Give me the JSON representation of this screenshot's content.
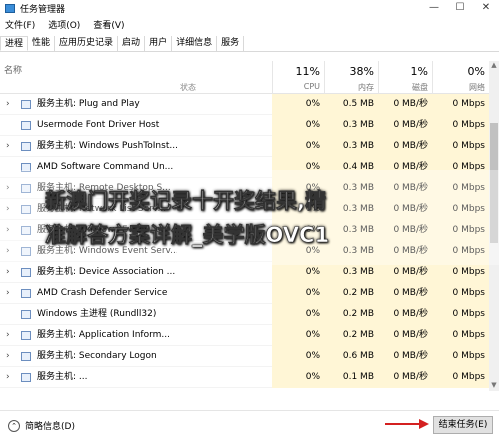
{
  "window": {
    "title": "任务管理器",
    "controls": [
      "—",
      "☐",
      "✕"
    ]
  },
  "menu": [
    "文件(F)",
    "选项(O)",
    "查看(V)"
  ],
  "tabs": [
    "进程",
    "性能",
    "应用历史记录",
    "启动",
    "用户",
    "详细信息",
    "服务"
  ],
  "columns": {
    "name": "名称",
    "status": "状态",
    "cpu": {
      "pct": "11%",
      "label": "CPU"
    },
    "memory": {
      "pct": "38%",
      "label": "内存"
    },
    "disk": {
      "pct": "1%",
      "label": "磁盘"
    },
    "network": {
      "pct": "0%",
      "label": "网络"
    }
  },
  "rows": [
    {
      "name": "服务主机: Plug and Play",
      "cpu": "0%",
      "mem": "0.5 MB",
      "disk": "0 MB/秒",
      "net": "0 Mbps",
      "expand": "›"
    },
    {
      "name": "Usermode Font Driver Host",
      "cpu": "0%",
      "mem": "0.3 MB",
      "disk": "0 MB/秒",
      "net": "0 Mbps",
      "expand": ""
    },
    {
      "name": "服务主机: Windows PushToInst...",
      "cpu": "0%",
      "mem": "0.3 MB",
      "disk": "0 MB/秒",
      "net": "0 Mbps",
      "expand": "›"
    },
    {
      "name": "AMD Software Command Un...",
      "cpu": "0%",
      "mem": "0.4 MB",
      "disk": "0 MB/秒",
      "net": "0 Mbps",
      "expand": ""
    },
    {
      "name": "服务主机: Remote Desktop S...",
      "cpu": "0%",
      "mem": "0.3 MB",
      "disk": "0 MB/秒",
      "net": "0 Mbps",
      "expand": "›"
    },
    {
      "name": "服务主机: Network List Serv...",
      "cpu": "0%",
      "mem": "0.3 MB",
      "disk": "0 MB/秒",
      "net": "0 Mbps",
      "expand": "›"
    },
    {
      "name": "服务主机: Windows Event Lo...",
      "cpu": "0%",
      "mem": "0.3 MB",
      "disk": "0 MB/秒",
      "net": "0 Mbps",
      "expand": "›"
    },
    {
      "name": "服务主机: Windows Event Serv...",
      "cpu": "0%",
      "mem": "0.3 MB",
      "disk": "0 MB/秒",
      "net": "0 Mbps",
      "expand": "›"
    },
    {
      "name": "服务主机: Device Association ...",
      "cpu": "0%",
      "mem": "0.3 MB",
      "disk": "0 MB/秒",
      "net": "0 Mbps",
      "expand": "›"
    },
    {
      "name": "AMD Crash Defender Service",
      "cpu": "0%",
      "mem": "0.2 MB",
      "disk": "0 MB/秒",
      "net": "0 Mbps",
      "expand": "›"
    },
    {
      "name": "Windows 主进程 (Rundll32)",
      "cpu": "0%",
      "mem": "0.2 MB",
      "disk": "0 MB/秒",
      "net": "0 Mbps",
      "expand": ""
    },
    {
      "name": "服务主机: Application Inform...",
      "cpu": "0%",
      "mem": "0.2 MB",
      "disk": "0 MB/秒",
      "net": "0 Mbps",
      "expand": "›"
    },
    {
      "name": "服务主机: Secondary Logon",
      "cpu": "0%",
      "mem": "0.6 MB",
      "disk": "0 MB/秒",
      "net": "0 Mbps",
      "expand": "›"
    },
    {
      "name": "服务主机: ...",
      "cpu": "0%",
      "mem": "0.1 MB",
      "disk": "0 MB/秒",
      "net": "0 Mbps",
      "expand": "›"
    }
  ],
  "overlay": {
    "line1": "新澳门开奖记录十开奖结果,精",
    "line2": "准解答方案详解_美学版OVC1"
  },
  "footer": {
    "fewer_details": "简略信息(D)",
    "end_task": "结束任务(E)"
  }
}
